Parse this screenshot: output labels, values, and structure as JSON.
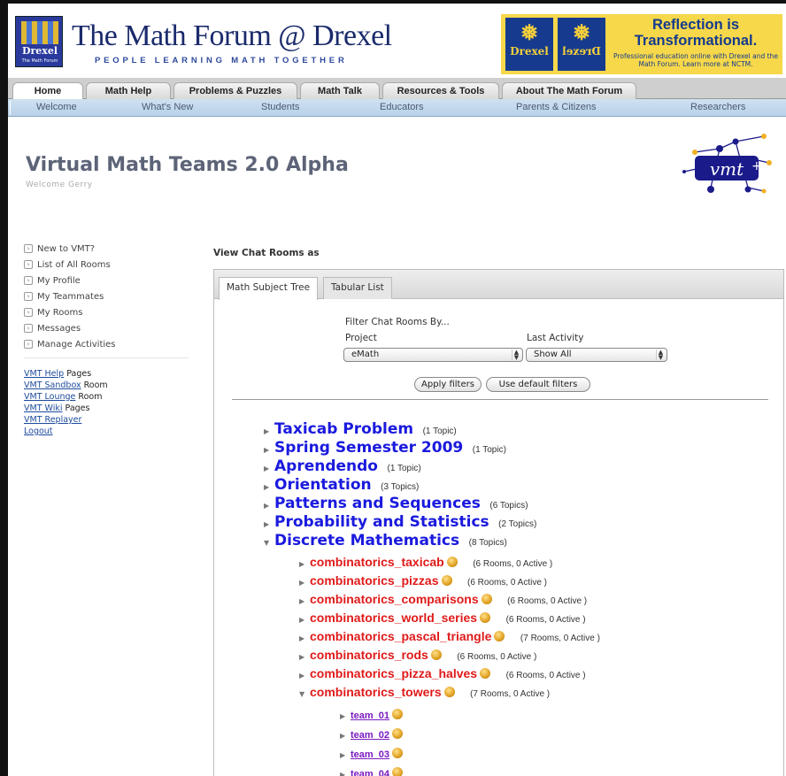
{
  "header": {
    "logo_text": "Drexel",
    "logo_sub": "The Math Forum",
    "title": "The Math Forum @ Drexel",
    "tagline": "PEOPLE LEARNING MATH TOGETHER",
    "ad": {
      "seal1": "Drexel",
      "seal2": "Drexel",
      "headline": "Reflection is Transformational.",
      "fine": "Professional education online with Drexel and the Math Forum. Learn more at NCTM."
    }
  },
  "nav": {
    "tabs": [
      "Home",
      "Math Help",
      "Problems & Puzzles",
      "Math Talk",
      "Resources & Tools",
      "About The Math Forum"
    ],
    "subnav": [
      "Welcome",
      "What's New",
      "Students",
      "Educators",
      "Parents & Citizens",
      "Researchers"
    ]
  },
  "page": {
    "title": "Virtual Math Teams 2.0 Alpha",
    "welcome": "Welcome Gerry",
    "logo_text": "vmt"
  },
  "sidebar": {
    "items": [
      "New to VMT?",
      "List of All Rooms",
      "My Profile",
      "My Teammates",
      "My Rooms",
      "Messages",
      "Manage Activities"
    ],
    "links": [
      {
        "link": "VMT Help",
        "suffix": "Pages"
      },
      {
        "link": "VMT Sandbox",
        "suffix": "Room"
      },
      {
        "link": "VMT Lounge",
        "suffix": "Room"
      },
      {
        "link": "VMT Wiki",
        "suffix": "Pages"
      },
      {
        "link": "VMT Replayer",
        "suffix": ""
      },
      {
        "link": "Logout",
        "suffix": ""
      }
    ]
  },
  "main": {
    "view_as": "View Chat Rooms as",
    "tabs": [
      "Math Subject Tree",
      "Tabular List"
    ],
    "filter": {
      "heading": "Filter Chat Rooms By...",
      "project_label": "Project",
      "project_value": "eMath",
      "activity_label": "Last Activity",
      "activity_value": "Show All",
      "apply": "Apply filters",
      "default": "Use default filters"
    },
    "subjects": [
      {
        "name": "Taxicab Problem",
        "count": "(1 Topic)"
      },
      {
        "name": "Spring Semester 2009",
        "count": "(1 Topic)"
      },
      {
        "name": "Aprendendo",
        "count": "(1 Topic)"
      },
      {
        "name": "Orientation",
        "count": "(3 Topics)"
      },
      {
        "name": "Patterns and Sequences",
        "count": "(6 Topics)"
      },
      {
        "name": "Probability and Statistics",
        "count": "(2 Topics)"
      },
      {
        "name": "Discrete Mathematics",
        "count": "(8 Topics)"
      }
    ],
    "topics": [
      {
        "name": "combinatorics_taxicab",
        "count": "(6 Rooms, 0 Active )"
      },
      {
        "name": "combinatorics_pizzas",
        "count": "(6 Rooms, 0 Active )"
      },
      {
        "name": "combinatorics_comparisons",
        "count": "(6 Rooms, 0 Active )"
      },
      {
        "name": "combinatorics_world_series",
        "count": "(6 Rooms, 0 Active )"
      },
      {
        "name": "combinatorics_pascal_triangle",
        "count": "(7 Rooms, 0 Active )"
      },
      {
        "name": "combinatorics_rods",
        "count": "(6 Rooms, 0 Active )"
      },
      {
        "name": "combinatorics_pizza_halves",
        "count": "(6 Rooms, 0 Active )"
      },
      {
        "name": "combinatorics_towers",
        "count": "(7 Rooms, 0 Active )"
      }
    ],
    "rooms": [
      "team_01",
      "team_02",
      "team_03",
      "team_04"
    ]
  },
  "colors": {
    "subject": "#1a1ade",
    "topic": "#e01a1a",
    "room": "#7a1ac0",
    "header_blue": "#1a2a6c"
  }
}
